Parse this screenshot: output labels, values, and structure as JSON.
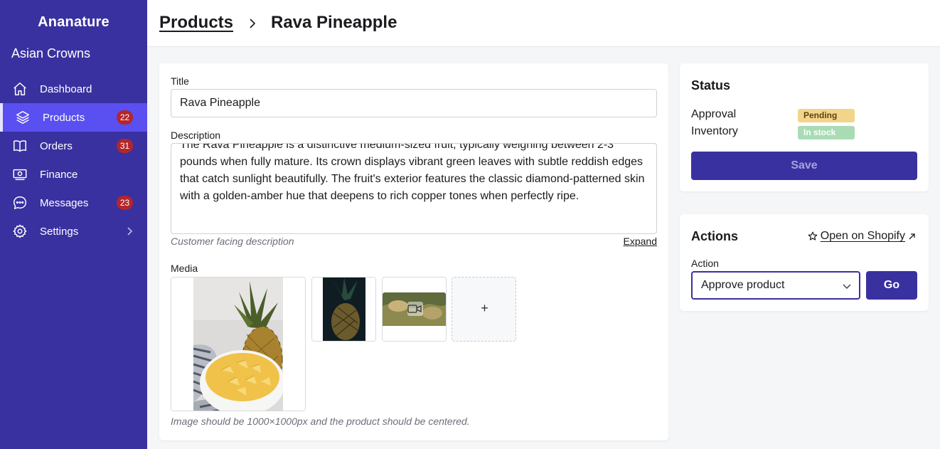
{
  "sidebar": {
    "brand": "Ananature",
    "store": "Asian Crowns",
    "items": [
      {
        "label": "Dashboard",
        "icon": "home-icon"
      },
      {
        "label": "Products",
        "icon": "layers-icon",
        "badge": "22",
        "active": true
      },
      {
        "label": "Orders",
        "icon": "book-icon",
        "badge": "31"
      },
      {
        "label": "Finance",
        "icon": "banknote-icon"
      },
      {
        "label": "Messages",
        "icon": "chat-bubble-icon",
        "badge": "23"
      },
      {
        "label": "Settings",
        "icon": "gear-icon"
      }
    ]
  },
  "breadcrumb": {
    "parent": "Products",
    "current": "Rava Pineapple"
  },
  "form": {
    "title_label": "Title",
    "title_value": "Rava Pineapple",
    "description_label": "Description",
    "description_value": "The Rava Pineapple is a distinctive medium-sized fruit, typically weighing between 2-3 pounds when fully mature. Its crown displays vibrant green leaves with subtle reddish edges that catch sunlight beautifully. The fruit's exterior features the classic diamond-patterned skin with a golden-amber hue that deepens to rich copper tones when perfectly ripe.",
    "description_hint": "Customer facing description",
    "expand_label": "Expand",
    "media_label": "Media",
    "media_hint": "Image should be 1000×1000px and the product should be centered.",
    "add_media_symbol": "+"
  },
  "status": {
    "title": "Status",
    "approval_label": "Approval",
    "approval_value": "Pending",
    "inventory_label": "Inventory",
    "inventory_value": "In stock",
    "save_label": "Save",
    "colors": {
      "pending_bg": "#f3d58a",
      "pending_text": "#5a4410",
      "instock_bg": "#a9dcb4",
      "instock_text": "#ffffff"
    }
  },
  "actions": {
    "title": "Actions",
    "shopify_link": "Open on Shopify",
    "action_label": "Action",
    "action_selected": "Approve product",
    "go_label": "Go"
  },
  "colors": {
    "sidebar": "#3a31a0",
    "active_nav": "#5a4ff0",
    "badge": "#b3262a",
    "primary": "#3a31a0"
  }
}
